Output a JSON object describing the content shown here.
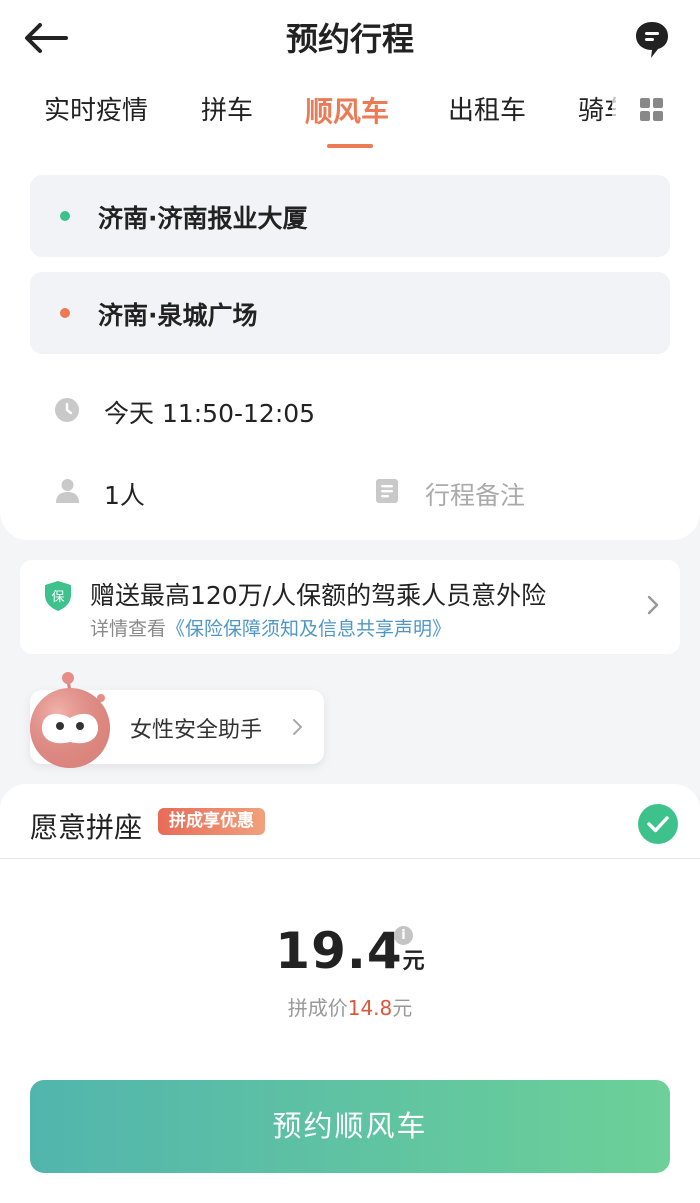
{
  "header": {
    "title": "预约行程"
  },
  "tabs": [
    {
      "label": "实时疫情",
      "active": false
    },
    {
      "label": "拼车",
      "active": false
    },
    {
      "label": "顺风车",
      "active": true
    },
    {
      "label": "出租车",
      "active": false
    },
    {
      "label": "骑车",
      "active": false
    }
  ],
  "trip": {
    "origin": "济南·济南报业大厦",
    "destination": "济南·泉城广场",
    "time": "今天 11:50-12:05",
    "passengers": "1人",
    "note_placeholder": "行程备注"
  },
  "insurance": {
    "title": "赠送最高120万/人保额的驾乘人员意外险",
    "detail_prefix": "详情查看",
    "detail_link": "《保险保障须知及信息共享声明》",
    "shield_text": "保"
  },
  "safety": {
    "label": "女性安全助手"
  },
  "carpool": {
    "label": "愿意拼座",
    "badge": "拼成享优惠",
    "checked": true
  },
  "price": {
    "amount": "19.4",
    "unit": "元",
    "info_symbol": "i",
    "carpool_prefix": "拼成价",
    "carpool_amount": "14.8",
    "carpool_unit": "元"
  },
  "action": {
    "book_label": "预约顺风车"
  },
  "colors": {
    "accent": "#ec7a55",
    "origin_dot": "#3ec28c",
    "destination_dot": "#ec7a55",
    "link": "#4f96c8",
    "button_start": "#52b5ad",
    "button_end": "#6cd098"
  }
}
